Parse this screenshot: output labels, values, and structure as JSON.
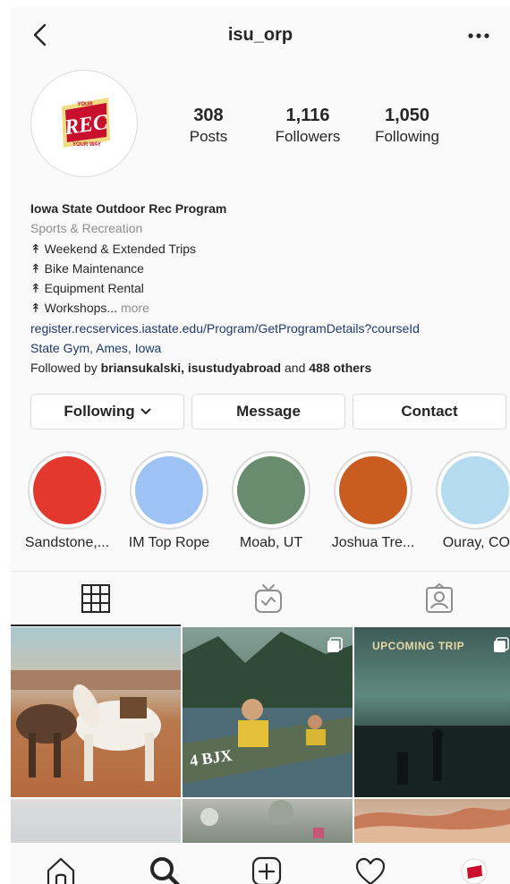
{
  "header": {
    "username": "isu_orp"
  },
  "profile": {
    "avatar_badge_top": "YOUR",
    "avatar_badge_main": "REC",
    "avatar_badge_bottom": "YOUR WAY",
    "stats": [
      {
        "value": "308",
        "label": "Posts"
      },
      {
        "value": "1,116",
        "label": "Followers"
      },
      {
        "value": "1,050",
        "label": "Following"
      }
    ]
  },
  "bio": {
    "name": "Iowa State Outdoor Rec Program",
    "category": "Sports & Recreation",
    "lines": [
      "↟ Weekend & Extended Trips",
      "↟ Bike Maintenance",
      "↟ Equipment Rental"
    ],
    "last_line": "↟ Workshops...",
    "more": " more",
    "link": "register.recservices.iastate.edu/Program/GetProgramDetails?courseId",
    "location": "State Gym, Ames, Iowa",
    "followed_prefix": "Followed by ",
    "followed_users": "briansukalski, isustudyabroad",
    "followed_and": " and ",
    "followed_others": "488 others"
  },
  "buttons": {
    "following": "Following",
    "message": "Message",
    "contact": "Contact"
  },
  "highlights": [
    {
      "label": "Sandstone,...",
      "color": "#e2382e"
    },
    {
      "label": "IM Top Rope",
      "color": "#9ec2f4"
    },
    {
      "label": "Moab, UT",
      "color": "#6a8c6e"
    },
    {
      "label": "Joshua Tre...",
      "color": "#c95c1f"
    },
    {
      "label": "Ouray, CO",
      "color": "#b4dcee"
    }
  ],
  "posts": {
    "tile3_text": "UPCOMING TRIP",
    "tile2_text": "4 BJX"
  },
  "colors": {
    "link": "#1e3a6e",
    "muted": "#8e8e8e",
    "border": "#dbdbdb"
  }
}
